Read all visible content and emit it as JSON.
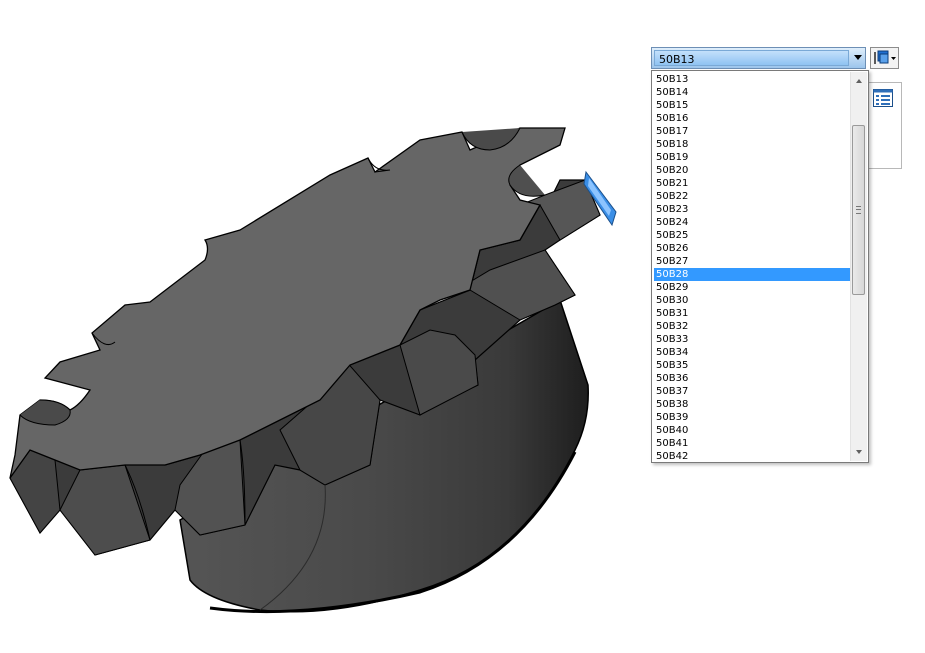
{
  "size_selector": {
    "value": "50B13",
    "options": [
      "50B13",
      "50B14",
      "50B15",
      "50B16",
      "50B17",
      "50B18",
      "50B19",
      "50B20",
      "50B21",
      "50B22",
      "50B23",
      "50B24",
      "50B25",
      "50B26",
      "50B27",
      "50B28",
      "50B29",
      "50B30",
      "50B31",
      "50B32",
      "50B33",
      "50B34",
      "50B35",
      "50B36",
      "50B37",
      "50B38",
      "50B39",
      "50B40",
      "50B41",
      "50B42"
    ],
    "highlighted": "50B28"
  },
  "colors": {
    "selection": "#3399ff",
    "model_face": "#666666",
    "edge_highlight": "#3a8ee6"
  },
  "icons": {
    "toolbar_button": "display-style-icon",
    "panel_button": "property-list-icon"
  }
}
